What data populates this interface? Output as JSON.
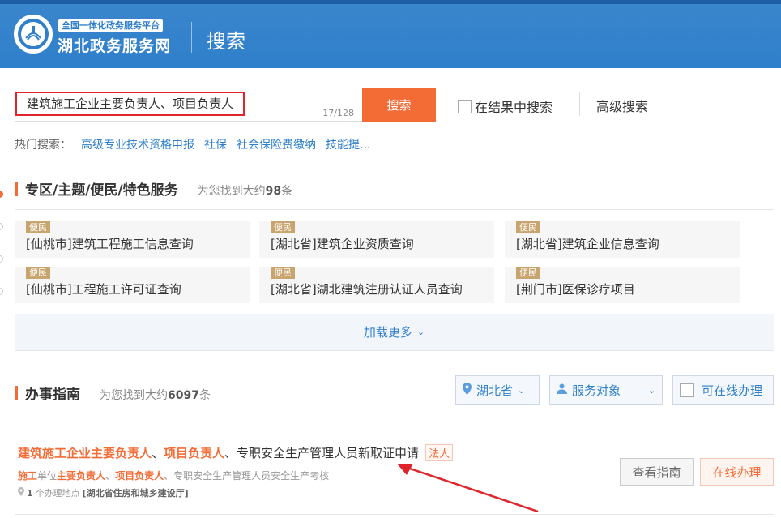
{
  "header": {
    "platform_label": "全国一体化政务服务平台",
    "site_name": "湖北政务服务网",
    "page_title": "搜索"
  },
  "search": {
    "value": "建筑施工企业主要负责人、项目负责人",
    "count": "17/128",
    "button_label": "搜索",
    "in_result_label": "在结果中搜索",
    "advanced_label": "高级搜索"
  },
  "hot": {
    "label": "热门搜索：",
    "items": [
      "高级专业技术资格申报",
      "社保",
      "社会保险费缴纳",
      "技能提..."
    ]
  },
  "services": {
    "title": "专区/主题/便民/特色服务",
    "count_prefix": "为您找到大约",
    "count": "98",
    "count_suffix": "条",
    "cards": [
      {
        "badge": "便民",
        "title": "[仙桃市]建筑工程施工信息查询"
      },
      {
        "badge": "便民",
        "title": "[湖北省]建筑企业资质查询"
      },
      {
        "badge": "便民",
        "title": "[湖北省]建筑企业信息查询"
      },
      {
        "badge": "便民",
        "title": "[仙桃市]工程施工许可证查询"
      },
      {
        "badge": "便民",
        "title": "[湖北省]湖北建筑注册认证人员查询"
      },
      {
        "badge": "便民",
        "title": "[荆门市]医保诊疗项目"
      }
    ],
    "load_more": "加载更多"
  },
  "guide": {
    "title": "办事指南",
    "count_prefix": "为您找到大约",
    "count": "6097",
    "count_suffix": "条",
    "filters": {
      "region": "湖北省",
      "audience": "服务对象",
      "online_label": "可在线办理"
    }
  },
  "result": {
    "title_hl1": "建筑施工企业主要负责人",
    "title_sep1": "、",
    "title_hl2": "项目负责人",
    "title_rest": "、专职安全生产管理人员新取证申请",
    "tag": "法人",
    "sub_hl1": "施工",
    "sub_t1": "单位",
    "sub_hl2": "主要负责人",
    "sub_t2": "、",
    "sub_hl3": "项目负责人",
    "sub_t3": "、专职安全生产管理人员安全生产考核",
    "loc_count": "1",
    "loc_text": "个办理地点",
    "loc_org": "[湖北省住房和城乡建设厅]",
    "btn_guide": "查看指南",
    "btn_online": "在线办理"
  },
  "colors": {
    "brand_blue": "#2f7fcb",
    "accent_orange": "#f36c36",
    "highlight_red": "#e0242b"
  }
}
